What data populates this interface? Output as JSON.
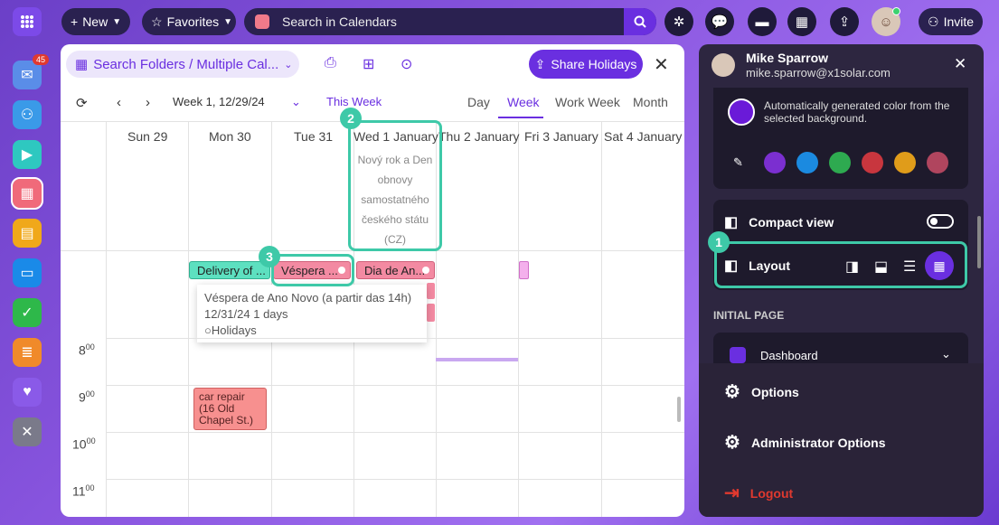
{
  "topbar": {
    "new_label": "New",
    "favorites_label": "Favorites",
    "search_placeholder": "Search in Calendars",
    "invite_label": "Invite"
  },
  "rail": {
    "mail_badge": "45"
  },
  "panel": {
    "folder_label": "Search Folders / Multiple Cal...",
    "share_label": "Share Holidays",
    "week_label": "Week 1, 12/29/24",
    "this_week": "This Week",
    "tabs": [
      "Day",
      "Week",
      "Work Week",
      "Month"
    ],
    "days": [
      "Sun 29",
      "Mon 30",
      "Tue 31",
      "Wed 1 January",
      "Thu 2 January",
      "Fri 3 January",
      "Sat 4 January"
    ],
    "holiday_text": [
      "Nový rok a Den",
      "obnovy",
      "samostatného",
      "českého státu",
      "(CZ)"
    ],
    "events": {
      "delivery": "Delivery of ...",
      "vespera": "Véspera ...",
      "dia": "Dia de An...",
      "car_repair": "car repair (16 Old Chapel St.)"
    },
    "tooltip": {
      "title": "Véspera de Ano Novo (a partir das 14h)",
      "date": "12/31/24",
      "duration": "1 days",
      "calendar": "Holidays"
    },
    "hours": [
      "8",
      "9",
      "10",
      "11"
    ],
    "hour_suffix": "00"
  },
  "menu": {
    "user_name": "Mike Sparrow",
    "user_email": "mike.sparrow@x1solar.com",
    "auto_color_text": "Automatically generated color from the selected background.",
    "compact_view": "Compact view",
    "layout": "Layout",
    "initial_page": "INITIAL PAGE",
    "dashboard": "Dashboard",
    "options": "Options",
    "admin_options": "Administrator Options",
    "logout": "Logout"
  },
  "annotations": [
    "1",
    "2",
    "3"
  ],
  "colors": {
    "accent": "#6a2fe0",
    "highlight": "#3ec9a8",
    "logout": "#e0392f",
    "swatches": [
      "#7b2fd0",
      "#1b8ae0",
      "#2eaa50",
      "#c8363e",
      "#e09c1a",
      "#b0455e"
    ]
  }
}
